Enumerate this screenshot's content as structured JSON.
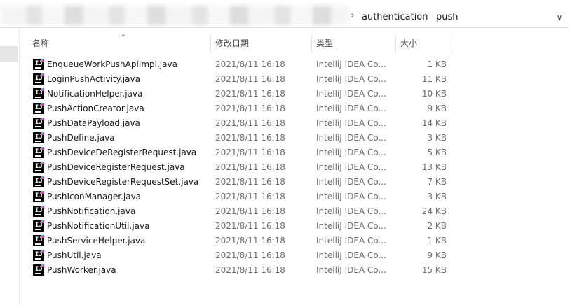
{
  "address_bar": {
    "breadcrumbs": [
      "authentication",
      "push"
    ],
    "separator_glyph": "›",
    "dropdown_glyph": "∨"
  },
  "columns": {
    "name": "名称",
    "modified": "修改日期",
    "type": "类型",
    "size": "大小"
  },
  "sort_indicator": "^",
  "files": [
    {
      "name": "EnqueueWorkPushApiImpl.java",
      "modified": "2021/8/11 16:18",
      "type": "IntelliJ IDEA Co...",
      "size": "1 KB"
    },
    {
      "name": "LoginPushActivity.java",
      "modified": "2021/8/11 16:18",
      "type": "IntelliJ IDEA Co...",
      "size": "11 KB"
    },
    {
      "name": "NotificationHelper.java",
      "modified": "2021/8/11 16:18",
      "type": "IntelliJ IDEA Co...",
      "size": "10 KB"
    },
    {
      "name": "PushActionCreator.java",
      "modified": "2021/8/11 16:18",
      "type": "IntelliJ IDEA Co...",
      "size": "9 KB"
    },
    {
      "name": "PushDataPayload.java",
      "modified": "2021/8/11 16:18",
      "type": "IntelliJ IDEA Co...",
      "size": "14 KB"
    },
    {
      "name": "PushDefine.java",
      "modified": "2021/8/11 16:18",
      "type": "IntelliJ IDEA Co...",
      "size": "3 KB"
    },
    {
      "name": "PushDeviceDeRegisterRequest.java",
      "modified": "2021/8/11 16:18",
      "type": "IntelliJ IDEA Co...",
      "size": "5 KB"
    },
    {
      "name": "PushDeviceRegisterRequest.java",
      "modified": "2021/8/11 16:18",
      "type": "IntelliJ IDEA Co...",
      "size": "13 KB"
    },
    {
      "name": "PushDeviceRegisterRequestSet.java",
      "modified": "2021/8/11 16:18",
      "type": "IntelliJ IDEA Co...",
      "size": "7 KB"
    },
    {
      "name": "PushIconManager.java",
      "modified": "2021/8/11 16:18",
      "type": "IntelliJ IDEA Co...",
      "size": "3 KB"
    },
    {
      "name": "PushNotification.java",
      "modified": "2021/8/11 16:18",
      "type": "IntelliJ IDEA Co...",
      "size": "24 KB"
    },
    {
      "name": "PushNotificationUtil.java",
      "modified": "2021/8/11 16:18",
      "type": "IntelliJ IDEA Co...",
      "size": "2 KB"
    },
    {
      "name": "PushServiceHelper.java",
      "modified": "2021/8/11 16:18",
      "type": "IntelliJ IDEA Co...",
      "size": "1 KB"
    },
    {
      "name": "PushUtil.java",
      "modified": "2021/8/11 16:18",
      "type": "IntelliJ IDEA Co...",
      "size": "9 KB"
    },
    {
      "name": "PushWorker.java",
      "modified": "2021/8/11 16:18",
      "type": "IntelliJ IDEA Co...",
      "size": "15 KB"
    }
  ],
  "file_icon": {
    "name": "intellij-java-file-icon",
    "glyph": "IJ"
  }
}
